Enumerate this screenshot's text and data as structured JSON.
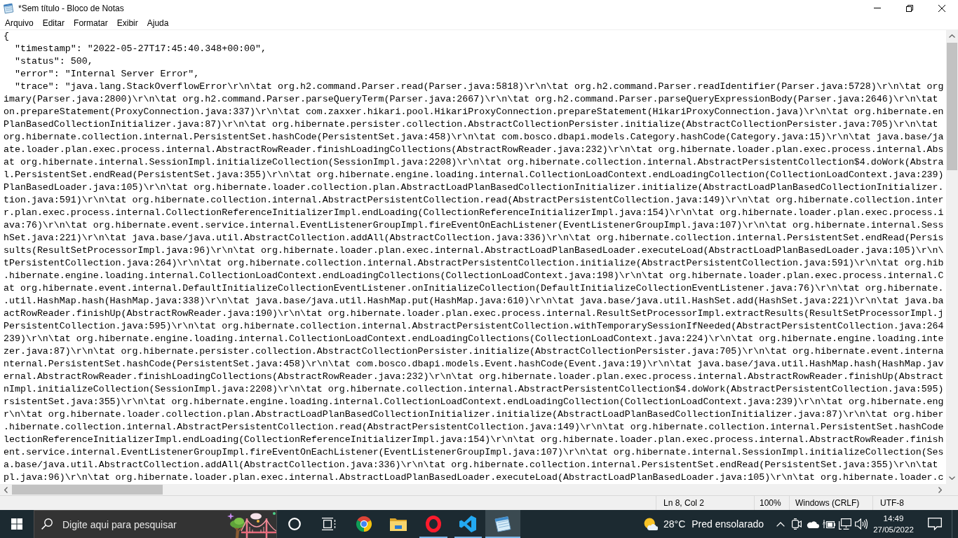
{
  "window": {
    "title": "*Sem título - Bloco de Notas"
  },
  "menu": [
    "Arquivo",
    "Editar",
    "Formatar",
    "Exibir",
    "Ajuda"
  ],
  "editor": {
    "lines": [
      "{",
      "  \"timestamp\": \"2022-05-27T17:45:40.348+00:00\",",
      "  \"status\": 500,",
      "  \"error\": \"Internal Server Error\",",
      "  \"trace\": \"java.lang.StackOverflowError\\r\\n\\tat org.h2.command.Parser.read(Parser.java:5818)\\r\\n\\tat org.h2.command.Parser.readIdentifier(Parser.java:5728)\\r\\n\\tat org",
      "imary(Parser.java:2800)\\r\\n\\tat org.h2.command.Parser.parseQueryTerm(Parser.java:2667)\\r\\n\\tat org.h2.command.Parser.parseQueryExpressionBody(Parser.java:2646)\\r\\n\\tat",
      "on.prepareStatement(ProxyConnection.java:337)\\r\\n\\tat com.zaxxer.hikari.pool.HikariProxyConnection.prepareStatement(HikariProxyConnection.java)\\r\\n\\tat org.hibernate.en",
      "PlanBasedCollectionInitializer.java:87)\\r\\n\\tat org.hibernate.persister.collection.AbstractCollectionPersister.initialize(AbstractCollectionPersister.java:705)\\r\\n\\tat",
      "org.hibernate.collection.internal.PersistentSet.hashCode(PersistentSet.java:458)\\r\\n\\tat com.bosco.dbapi.models.Category.hashCode(Category.java:15)\\r\\n\\tat java.base/ja",
      "ate.loader.plan.exec.process.internal.AbstractRowReader.finishLoadingCollections(AbstractRowReader.java:232)\\r\\n\\tat org.hibernate.loader.plan.exec.process.internal.Abs",
      "at org.hibernate.internal.SessionImpl.initializeCollection(SessionImpl.java:2208)\\r\\n\\tat org.hibernate.collection.internal.AbstractPersistentCollection$4.doWork(Abstra",
      "l.PersistentSet.endRead(PersistentSet.java:355)\\r\\n\\tat org.hibernate.engine.loading.internal.CollectionLoadContext.endLoadingCollection(CollectionLoadContext.java:239)",
      "PlanBasedLoader.java:105)\\r\\n\\tat org.hibernate.loader.collection.plan.AbstractLoadPlanBasedCollectionInitializer.initialize(AbstractLoadPlanBasedCollectionInitializer.",
      "tion.java:591)\\r\\n\\tat org.hibernate.collection.internal.AbstractPersistentCollection.read(AbstractPersistentCollection.java:149)\\r\\n\\tat org.hibernate.collection.inter",
      "r.plan.exec.process.internal.CollectionReferenceInitializerImpl.endLoading(CollectionReferenceInitializerImpl.java:154)\\r\\n\\tat org.hibernate.loader.plan.exec.process.i",
      "ava:76)\\r\\n\\tat org.hibernate.event.service.internal.EventListenerGroupImpl.fireEventOnEachListener(EventListenerGroupImpl.java:107)\\r\\n\\tat org.hibernate.internal.Sess",
      "hSet.java:221)\\r\\n\\tat java.base/java.util.AbstractCollection.addAll(AbstractCollection.java:336)\\r\\n\\tat org.hibernate.collection.internal.PersistentSet.endRead(Persis",
      "sults(ResultSetProcessorImpl.java:96)\\r\\n\\tat org.hibernate.loader.plan.exec.internal.AbstractLoadPlanBasedLoader.executeLoad(AbstractLoadPlanBasedLoader.java:105)\\r\\n\\",
      "tPersistentCollection.java:264)\\r\\n\\tat org.hibernate.collection.internal.AbstractPersistentCollection.initialize(AbstractPersistentCollection.java:591)\\r\\n\\tat org.hib",
      ".hibernate.engine.loading.internal.CollectionLoadContext.endLoadingCollections(CollectionLoadContext.java:198)\\r\\n\\tat org.hibernate.loader.plan.exec.process.internal.C",
      "at org.hibernate.event.internal.DefaultInitializeCollectionEventListener.onInitializeCollection(DefaultInitializeCollectionEventListener.java:76)\\r\\n\\tat org.hibernate.",
      ".util.HashMap.hash(HashMap.java:338)\\r\\n\\tat java.base/java.util.HashMap.put(HashMap.java:610)\\r\\n\\tat java.base/java.util.HashSet.add(HashSet.java:221)\\r\\n\\tat java.ba",
      "actRowReader.finishUp(AbstractRowReader.java:190)\\r\\n\\tat org.hibernate.loader.plan.exec.process.internal.ResultSetProcessorImpl.extractResults(ResultSetProcessorImpl.j",
      "PersistentCollection.java:595)\\r\\n\\tat org.hibernate.collection.internal.AbstractPersistentCollection.withTemporarySessionIfNeeded(AbstractPersistentCollection.java:264",
      "239)\\r\\n\\tat org.hibernate.engine.loading.internal.CollectionLoadContext.endLoadingCollections(CollectionLoadContext.java:224)\\r\\n\\tat org.hibernate.engine.loading.inte",
      "zer.java:87)\\r\\n\\tat org.hibernate.persister.collection.AbstractCollectionPersister.initialize(AbstractCollectionPersister.java:705)\\r\\n\\tat org.hibernate.event.interna",
      "nternal.PersistentSet.hashCode(PersistentSet.java:458)\\r\\n\\tat com.bosco.dbapi.models.Event.hashCode(Event.java:19)\\r\\n\\tat java.base/java.util.HashMap.hash(HashMap.jav",
      "ernal.AbstractRowReader.finishLoadingCollections(AbstractRowReader.java:232)\\r\\n\\tat org.hibernate.loader.plan.exec.process.internal.AbstractRowReader.finishUp(Abstract",
      "nImpl.initializeCollection(SessionImpl.java:2208)\\r\\n\\tat org.hibernate.collection.internal.AbstractPersistentCollection$4.doWork(AbstractPersistentCollection.java:595)",
      "rsistentSet.java:355)\\r\\n\\tat org.hibernate.engine.loading.internal.CollectionLoadContext.endLoadingCollection(CollectionLoadContext.java:239)\\r\\n\\tat org.hibernate.eng",
      "r\\n\\tat org.hibernate.loader.collection.plan.AbstractLoadPlanBasedCollectionInitializer.initialize(AbstractLoadPlanBasedCollectionInitializer.java:87)\\r\\n\\tat org.hiber",
      ".hibernate.collection.internal.AbstractPersistentCollection.read(AbstractPersistentCollection.java:149)\\r\\n\\tat org.hibernate.collection.internal.PersistentSet.hashCode",
      "lectionReferenceInitializerImpl.endLoading(CollectionReferenceInitializerImpl.java:154)\\r\\n\\tat org.hibernate.loader.plan.exec.process.internal.AbstractRowReader.finish",
      "ent.service.internal.EventListenerGroupImpl.fireEventOnEachListener(EventListenerGroupImpl.java:107)\\r\\n\\tat org.hibernate.internal.SessionImpl.initializeCollection(Ses",
      "a.base/java.util.AbstractCollection.addAll(AbstractCollection.java:336)\\r\\n\\tat org.hibernate.collection.internal.PersistentSet.endRead(PersistentSet.java:355)\\r\\n\\tat",
      "pl.java:96)\\r\\n\\tat org.hibernate.loader.plan.exec.internal.AbstractLoadPlanBasedLoader.executeLoad(AbstractLoadPlanBasedLoader.java:105)\\r\\n\\tat org.hibernate.loader.c"
    ]
  },
  "status_bar": {
    "position": "Ln 8, Col 2",
    "zoom": "100%",
    "line_ending": "Windows (CRLF)",
    "encoding": "UTF-8"
  },
  "taskbar": {
    "search": {
      "placeholder": "Digite aqui para pesquisar"
    },
    "apps": [
      {
        "kind": "chrome",
        "running": false,
        "selected": false
      },
      {
        "kind": "explorer",
        "running": false,
        "selected": false
      },
      {
        "kind": "opera",
        "running": true,
        "selected": false
      },
      {
        "kind": "vscode",
        "running": true,
        "selected": false
      },
      {
        "kind": "notepad",
        "running": true,
        "selected": true
      }
    ],
    "weather": {
      "temperature": "28°C",
      "condition": "Pred ensolarado"
    },
    "clock": {
      "time": "14:49",
      "date": "27/05/2022"
    }
  }
}
